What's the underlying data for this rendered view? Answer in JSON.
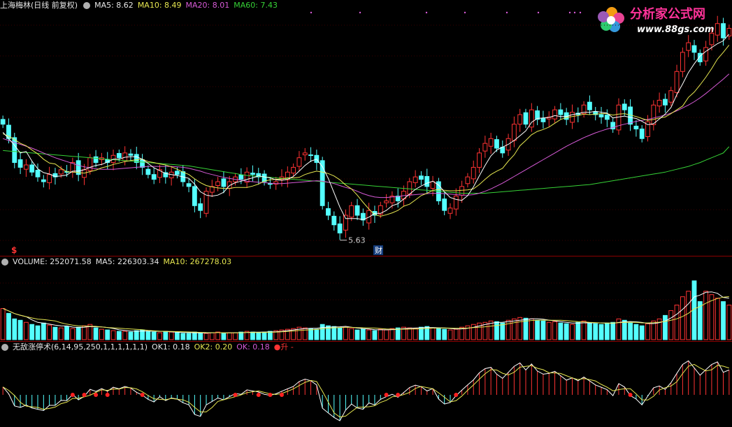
{
  "price_header": {
    "title": "上海梅林(日线 前复权)",
    "ma5": "MA5: 8.62",
    "ma10": "MA10: 8.49",
    "ma20": "MA20: 8.01",
    "ma60": "MA60: 7.43"
  },
  "volume_header": {
    "volume": "VOLUME: 252071.58",
    "ma5": "MA5: 226303.34",
    "ma10": "MA10: 267278.03"
  },
  "indicator_header": {
    "name": "无敌涨停术(6,14,95,250,1,1,1,1,1,1)",
    "ok1": "OK1: 0.18",
    "ok2": "OK2: 0.20",
    "ok": "OK: 0.18",
    "rise": "●升 -"
  },
  "annotations": {
    "low_label": "5.63",
    "finance_marker": "财",
    "s_marker": "$"
  },
  "watermark": {
    "brand": "分析家公式网",
    "url": "www.88gs.com"
  },
  "colors": {
    "background": "#000000",
    "up": "#ff3333",
    "down": "#54ffff",
    "ma5": "#ffffff",
    "ma10": "#e6e650",
    "ma20": "#d65ad6",
    "ma60": "#36d136",
    "divider": "#8b0000",
    "dot": "#ff2020"
  },
  "chart_data": {
    "type": "candlestick",
    "price_ylim": [
      5.3,
      10.2
    ],
    "closes": [
      7.9,
      7.6,
      7.1,
      7.0,
      7.05,
      6.9,
      6.8,
      6.7,
      6.85,
      6.8,
      6.95,
      6.9,
      7.1,
      6.85,
      6.95,
      7.2,
      7.1,
      7.2,
      7.1,
      7.25,
      7.2,
      7.3,
      7.25,
      7.1,
      7.0,
      6.85,
      6.75,
      6.95,
      6.8,
      6.9,
      6.85,
      6.7,
      6.6,
      6.2,
      6.1,
      6.5,
      6.6,
      6.7,
      6.6,
      6.7,
      6.8,
      6.75,
      6.9,
      6.85,
      6.8,
      6.7,
      6.65,
      6.7,
      6.8,
      6.9,
      7.0,
      7.2,
      7.3,
      7.25,
      7.1,
      6.2,
      6.0,
      5.8,
      5.63,
      6.0,
      6.2,
      6.0,
      5.9,
      6.1,
      6.0,
      6.2,
      6.3,
      6.4,
      6.3,
      6.5,
      6.7,
      6.8,
      6.75,
      6.6,
      6.7,
      6.3,
      6.1,
      6.15,
      6.4,
      6.6,
      6.8,
      7.0,
      7.3,
      7.5,
      7.6,
      7.4,
      7.3,
      7.6,
      7.9,
      8.1,
      7.9,
      8.2,
      8.0,
      7.95,
      8.05,
      8.2,
      8.1,
      8.0,
      8.15,
      8.1,
      8.3,
      8.2,
      8.1,
      8.05,
      8.0,
      7.8,
      8.3,
      8.2,
      7.9,
      7.8,
      7.6,
      7.95,
      8.3,
      8.4,
      8.3,
      8.6,
      9.0,
      9.4,
      9.6,
      9.4,
      9.2,
      9.5,
      9.8,
      10.0,
      9.7,
      9.9
    ],
    "ma5": [
      7.73,
      7.6,
      7.46,
      7.3,
      7.33,
      7.13,
      6.97,
      6.89,
      6.86,
      6.81,
      6.82,
      6.84,
      6.92,
      6.92,
      6.95,
      7.0,
      7.04,
      7.06,
      7.11,
      7.17,
      7.17,
      7.21,
      7.22,
      7.22,
      7.17,
      7.08,
      6.99,
      6.93,
      6.87,
      6.85,
      6.83,
      6.8,
      6.77,
      6.65,
      6.49,
      6.42,
      6.4,
      6.42,
      6.48,
      6.62,
      6.68,
      6.71,
      6.75,
      6.78,
      6.82,
      6.8,
      6.78,
      6.74,
      6.73,
      6.75,
      6.81,
      6.92,
      7.04,
      7.13,
      7.17,
      7.01,
      6.77,
      6.47,
      6.17,
      5.93,
      5.93,
      5.93,
      5.91,
      5.96,
      6.04,
      6.04,
      6.1,
      6.2,
      6.24,
      6.34,
      6.44,
      6.54,
      6.61,
      6.67,
      6.71,
      6.63,
      6.49,
      6.37,
      6.33,
      6.31,
      6.41,
      6.59,
      6.82,
      7.04,
      7.24,
      7.36,
      7.42,
      7.48,
      7.56,
      7.66,
      7.76,
      7.94,
      8.02,
      8.03,
      8.04,
      8.08,
      8.06,
      8.06,
      8.1,
      8.12,
      8.15,
      8.15,
      8.17,
      8.15,
      8.13,
      8.03,
      8.05,
      8.07,
      8.04,
      8.02,
      7.96,
      7.89,
      7.91,
      8.01,
      8.11,
      8.25,
      8.52,
      8.74,
      8.98,
      9.16,
      9.32,
      9.42,
      9.5,
      9.58,
      9.64,
      9.78
    ],
    "ma10": [
      7.7,
      7.65,
      7.58,
      7.5,
      7.45,
      7.36,
      7.28,
      7.17,
      7.09,
      7.07,
      6.98,
      6.91,
      6.9,
      6.89,
      6.88,
      6.91,
      6.94,
      6.99,
      7.02,
      7.06,
      7.09,
      7.12,
      7.14,
      7.16,
      7.17,
      7.12,
      7.1,
      7.07,
      7.05,
      7.01,
      6.96,
      6.9,
      6.85,
      6.76,
      6.68,
      6.62,
      6.59,
      6.57,
      6.56,
      6.56,
      6.58,
      6.58,
      6.58,
      6.61,
      6.65,
      6.71,
      6.74,
      6.75,
      6.76,
      6.78,
      6.78,
      6.79,
      6.85,
      6.89,
      6.92,
      6.9,
      6.87,
      6.82,
      6.74,
      6.63,
      6.55,
      6.42,
      6.27,
      6.13,
      6.01,
      5.98,
      6.01,
      6.05,
      6.1,
      6.19,
      6.23,
      6.32,
      6.41,
      6.46,
      6.52,
      6.54,
      6.52,
      6.51,
      6.51,
      6.52,
      6.53,
      6.55,
      6.64,
      6.75,
      6.85,
      6.92,
      6.98,
      7.13,
      7.26,
      7.45,
      7.56,
      7.68,
      7.75,
      7.79,
      7.84,
      7.92,
      8.0,
      8.04,
      8.06,
      8.08,
      8.11,
      8.1,
      8.11,
      8.12,
      8.12,
      8.09,
      8.11,
      8.12,
      8.09,
      8.06,
      8.02,
      7.98,
      8.0,
      8.03,
      8.05,
      8.12,
      8.2,
      8.28,
      8.46,
      8.57,
      8.72,
      8.88,
      9.06,
      9.26,
      9.4,
      9.55
    ],
    "ma20": [
      7.6,
      7.56,
      7.52,
      7.48,
      7.44,
      7.4,
      7.35,
      7.3,
      7.25,
      7.2,
      7.16,
      7.12,
      7.08,
      7.04,
      7.01,
      6.99,
      6.97,
      6.96,
      6.96,
      6.96,
      6.97,
      6.98,
      6.99,
      7.0,
      7.01,
      7.02,
      7.02,
      7.02,
      7.02,
      7.02,
      7.01,
      7.0,
      6.98,
      6.95,
      6.92,
      6.88,
      6.85,
      6.82,
      6.79,
      6.77,
      6.75,
      6.73,
      6.71,
      6.7,
      6.69,
      6.68,
      6.67,
      6.66,
      6.66,
      6.67,
      6.68,
      6.69,
      6.7,
      6.71,
      6.72,
      6.71,
      6.69,
      6.66,
      6.62,
      6.58,
      6.55,
      6.5,
      6.45,
      6.41,
      6.38,
      6.37,
      6.37,
      6.38,
      6.39,
      6.41,
      6.42,
      6.43,
      6.44,
      6.45,
      6.46,
      6.46,
      6.45,
      6.44,
      6.43,
      6.42,
      6.42,
      6.43,
      6.46,
      6.5,
      6.55,
      6.61,
      6.67,
      6.74,
      6.81,
      6.88,
      6.95,
      7.02,
      7.09,
      7.16,
      7.23,
      7.3,
      7.37,
      7.44,
      7.5,
      7.56,
      7.62,
      7.67,
      7.72,
      7.76,
      7.8,
      7.83,
      7.87,
      7.9,
      7.93,
      7.96,
      7.98,
      8.0,
      8.03,
      8.06,
      8.09,
      8.13,
      8.18,
      8.24,
      8.3,
      8.37,
      8.45,
      8.54,
      8.64,
      8.74,
      8.84,
      8.95
    ],
    "ma60": [
      7.35,
      7.34,
      7.33,
      7.32,
      7.31,
      7.3,
      7.29,
      7.28,
      7.27,
      7.26,
      7.25,
      7.24,
      7.23,
      7.22,
      7.21,
      7.2,
      7.19,
      7.18,
      7.17,
      7.16,
      7.15,
      7.14,
      7.13,
      7.12,
      7.11,
      7.1,
      7.09,
      7.08,
      7.07,
      7.06,
      7.05,
      7.04,
      7.03,
      7.01,
      6.99,
      6.97,
      6.95,
      6.93,
      6.91,
      6.89,
      6.87,
      6.85,
      6.83,
      6.82,
      6.81,
      6.8,
      6.79,
      6.78,
      6.77,
      6.76,
      6.75,
      6.74,
      6.73,
      6.72,
      6.71,
      6.7,
      6.69,
      6.68,
      6.67,
      6.66,
      6.65,
      6.64,
      6.63,
      6.62,
      6.61,
      6.6,
      6.59,
      6.58,
      6.57,
      6.56,
      6.55,
      6.54,
      6.53,
      6.52,
      6.51,
      6.5,
      6.49,
      6.48,
      6.47,
      6.46,
      6.46,
      6.46,
      6.46,
      6.46,
      6.47,
      6.48,
      6.49,
      6.5,
      6.51,
      6.52,
      6.53,
      6.54,
      6.55,
      6.56,
      6.57,
      6.58,
      6.59,
      6.6,
      6.61,
      6.62,
      6.63,
      6.64,
      6.66,
      6.68,
      6.7,
      6.72,
      6.74,
      6.76,
      6.78,
      6.8,
      6.82,
      6.84,
      6.86,
      6.88,
      6.9,
      6.93,
      6.96,
      6.99,
      7.02,
      7.06,
      7.1,
      7.15,
      7.2,
      7.25,
      7.3,
      7.43
    ],
    "volumes": [
      0.45,
      0.38,
      0.3,
      0.28,
      0.25,
      0.22,
      0.2,
      0.24,
      0.21,
      0.18,
      0.17,
      0.19,
      0.16,
      0.18,
      0.2,
      0.22,
      0.17,
      0.15,
      0.14,
      0.13,
      0.12,
      0.12,
      0.11,
      0.13,
      0.14,
      0.12,
      0.11,
      0.1,
      0.12,
      0.11,
      0.1,
      0.09,
      0.09,
      0.11,
      0.1,
      0.09,
      0.1,
      0.11,
      0.09,
      0.1,
      0.1,
      0.11,
      0.12,
      0.11,
      0.1,
      0.11,
      0.12,
      0.13,
      0.14,
      0.15,
      0.16,
      0.18,
      0.17,
      0.16,
      0.15,
      0.22,
      0.2,
      0.19,
      0.17,
      0.18,
      0.16,
      0.14,
      0.15,
      0.14,
      0.13,
      0.15,
      0.14,
      0.16,
      0.17,
      0.18,
      0.17,
      0.16,
      0.18,
      0.19,
      0.17,
      0.16,
      0.15,
      0.14,
      0.15,
      0.18,
      0.2,
      0.22,
      0.24,
      0.25,
      0.27,
      0.26,
      0.24,
      0.28,
      0.3,
      0.32,
      0.31,
      0.3,
      0.28,
      0.27,
      0.25,
      0.26,
      0.24,
      0.23,
      0.22,
      0.25,
      0.27,
      0.24,
      0.23,
      0.22,
      0.24,
      0.25,
      0.3,
      0.28,
      0.24,
      0.22,
      0.2,
      0.23,
      0.27,
      0.3,
      0.35,
      0.42,
      0.5,
      0.62,
      0.7,
      0.85,
      0.55,
      0.7,
      0.65,
      0.6,
      0.55,
      0.5
    ],
    "volume_ylim": [
      0,
      1.0
    ],
    "indicator_ylim": [
      -1,
      1
    ]
  }
}
